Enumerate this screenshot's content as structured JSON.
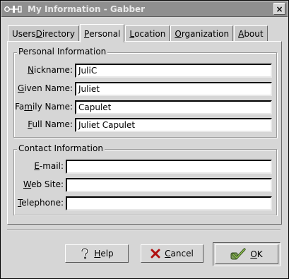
{
  "window": {
    "title": "My Information - Gabber",
    "close_label": "×"
  },
  "tabs": [
    {
      "label_pre": "Users ",
      "label_ul": "D",
      "label_post": "irectory",
      "active": false
    },
    {
      "label_pre": "",
      "label_ul": "P",
      "label_post": "ersonal",
      "active": true
    },
    {
      "label_pre": "",
      "label_ul": "L",
      "label_post": "ocation",
      "active": false
    },
    {
      "label_pre": "",
      "label_ul": "O",
      "label_post": "rganization",
      "active": false
    },
    {
      "label_pre": "",
      "label_ul": "A",
      "label_post": "bout",
      "active": false
    }
  ],
  "personal": {
    "legend": "Personal Information",
    "nickname": {
      "ul": "N",
      "rest": "ickname:",
      "value": "JuliC"
    },
    "given_name": {
      "ul": "G",
      "rest": "iven Name:",
      "value": "Juliet"
    },
    "family_name": {
      "pre": "Fa",
      "ul": "m",
      "rest": "ily Name:",
      "value": "Capulet"
    },
    "full_name": {
      "ul": "F",
      "rest": "ull Name:",
      "value": "Juliet Capulet"
    }
  },
  "contact": {
    "legend": "Contact Information",
    "email": {
      "ul": "E",
      "rest": "-mail:",
      "value": ""
    },
    "website": {
      "ul": "W",
      "rest": "eb Site:",
      "value": ""
    },
    "telephone": {
      "ul": "T",
      "rest": "elephone:",
      "value": ""
    }
  },
  "buttons": {
    "help": {
      "ul": "H",
      "rest": "elp"
    },
    "cancel": {
      "ul": "C",
      "rest": "ancel"
    },
    "ok": {
      "ul": "O",
      "rest": "K"
    }
  },
  "icons": {
    "app": "gabber-app-icon",
    "help": "question-mark-icon",
    "cancel": "red-x-icon",
    "ok": "green-checkmark-icon"
  }
}
